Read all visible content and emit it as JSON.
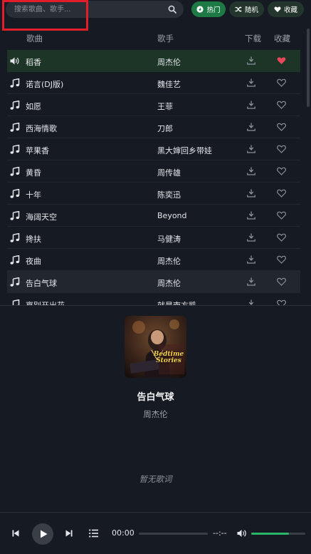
{
  "search": {
    "placeholder": "搜索歌曲、歌手..."
  },
  "toolbar": {
    "hot_label": "热门",
    "random_label": "随机",
    "favorites_label": "收藏"
  },
  "columns": {
    "song": "歌曲",
    "artist": "歌手",
    "download": "下载",
    "favorite": "收藏"
  },
  "songs": [
    {
      "title": "稻香",
      "artist": "周杰伦",
      "playing": true,
      "favorited": true
    },
    {
      "title": "诺言(DJ版)",
      "artist": "魏佳艺",
      "playing": false,
      "favorited": false
    },
    {
      "title": "如愿",
      "artist": "王菲",
      "playing": false,
      "favorited": false
    },
    {
      "title": "西海情歌",
      "artist": "刀郎",
      "playing": false,
      "favorited": false
    },
    {
      "title": "苹果香",
      "artist": "黑大婶回乡带娃",
      "playing": false,
      "favorited": false
    },
    {
      "title": "黄昏",
      "artist": "周传雄",
      "playing": false,
      "favorited": false
    },
    {
      "title": "十年",
      "artist": "陈奕迅",
      "playing": false,
      "favorited": false
    },
    {
      "title": "海阔天空",
      "artist": "Beyond",
      "playing": false,
      "favorited": false
    },
    {
      "title": "搀扶",
      "artist": "马健涛",
      "playing": false,
      "favorited": false
    },
    {
      "title": "夜曲",
      "artist": "周杰伦",
      "playing": false,
      "favorited": false
    },
    {
      "title": "告白气球",
      "artist": "周杰伦",
      "playing": false,
      "favorited": false
    },
    {
      "title": "离别开出花",
      "artist": "就是南方凯",
      "playing": false,
      "favorited": false
    }
  ],
  "now_playing": {
    "title": "告白气球",
    "artist": "周杰伦",
    "lyrics_placeholder": "暂无歌词",
    "cover_text": "Bedtime Stories"
  },
  "player": {
    "current_time": "00:00",
    "duration": "--:--",
    "progress": 0,
    "volume": 0.7
  },
  "colors": {
    "accent": "#2bb568",
    "hot_button": "#1e7a45",
    "favorite": "#e8465a",
    "active_row": "#1d3527"
  },
  "icons": {
    "search": "search-icon",
    "hot": "fire-icon",
    "random": "shuffle-icon",
    "favorites": "heart-icon",
    "playing": "speaker-icon",
    "song": "music-note-icon",
    "download": "download-icon",
    "favorite": "heart-icon"
  }
}
